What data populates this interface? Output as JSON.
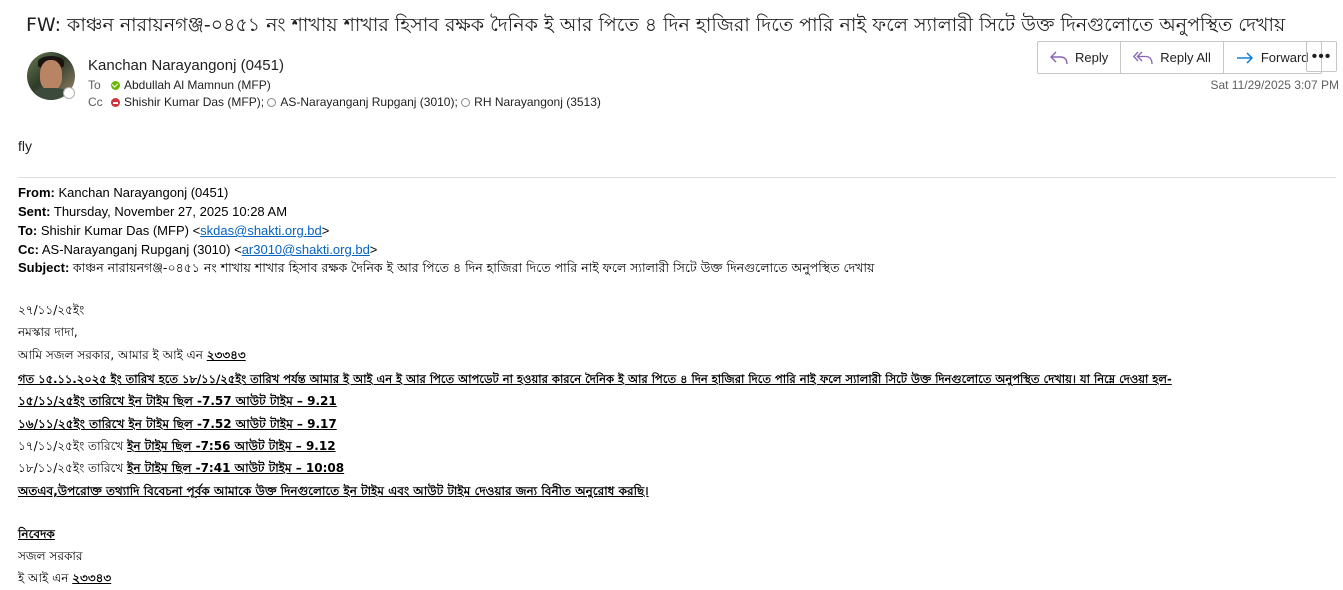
{
  "subject": "FW: কাঞ্চন নারায়নগঞ্জ-০৪৫১ নং শাখায়  শাখার হিসাব রক্ষক দৈনিক  ই আর পিতে ৪ দিন হাজিরা দিতে পারি নাই ফলে স্যালারী সিটে উক্ত দিনগুলোতে অনুপস্থিত দেখায়",
  "header": {
    "sender": "Kanchan  Narayangonj (0451)",
    "to_label": "To",
    "to": [
      {
        "name": "Abdullah Al Mamnun (MFP)",
        "status": "available"
      }
    ],
    "cc_label": "Cc",
    "cc": [
      {
        "name": "Shishir Kumar Das (MFP);",
        "status": "busy"
      },
      {
        "name": "AS-Narayanganj Rupganj (3010);",
        "status": "offline"
      },
      {
        "name": "RH Narayangonj (3513)",
        "status": "offline"
      }
    ],
    "date": "Sat 11/29/2025 3:07 PM"
  },
  "actions": {
    "reply": "Reply",
    "reply_all": "Reply All",
    "forward": "Forward",
    "more": "•••"
  },
  "colors": {
    "reply_icon": "#8764b8",
    "forward_icon": "#0078d4",
    "link": "#0563c1"
  },
  "body": {
    "intro": "fly",
    "forwarded": {
      "from_label": "From:",
      "from": "Kanchan Narayangonj (0451)",
      "sent_label": "Sent:",
      "sent": "Thursday, November 27, 2025 10:28 AM",
      "to_label": "To:",
      "to_name": "Shishir Kumar Das (MFP) <",
      "to_email": "skdas@shakti.org.bd",
      "to_close": ">",
      "cc_label": "Cc:",
      "cc_name": "AS-Narayanganj Rupganj (3010) <",
      "cc_email": "ar3010@shakti.org.bd",
      "cc_close": ">",
      "subject_label": "Subject:",
      "subject": "কাঞ্চন নারায়নগঞ্জ-০৪৫১ নং শাখায় শাখার হিসাব রক্ষক দৈনিক ই আর পিতে ৪ দিন হাজিরা দিতে পারি নাই ফলে স্যালারী সিটে উক্ত দিনগুলোতে অনুপস্থিত দেখায়"
    },
    "letter": {
      "date": "২৭/১১/২৫ইং",
      "greeting": "নমস্কার দাদা,",
      "intro_plain": "আমি সজল সরকার, আমার  ই আই এন ",
      "intro_id": "২৩৩৪৩",
      "paragraph": "গত ১৫.১১.২০২৫ ইং তারিখ হতে ১৮/১১/২৫ইং তারিখ পর্যন্ত  আমার ই আই এন  ই আর পিতে আপডেট না হওয়ার কারনে দৈনিক  ই আর পিতে ৪ দিন হাজিরা দিতে পারি নাই ফলে স্যালারী সিটে উক্ত দিনগুলোতে অনুপস্থিত দেখায়। যা নিম্নে দেওয়া হল-",
      "line1": "১৫/১১/২৫ইং তারিখে ইন টাইম ছিল -7.57 আউট টাইম – 9.21",
      "line2": "১৬/১১/২৫ইং তারিখে ইন টাইম ছিল -7.52 আউট টাইম – 9.17",
      "line3_plain": "১৭/১১/২৫ইং তারিখে ",
      "line3_u": "ইন টাইম ছিল -7:56 আউট টাইম – 9.12",
      "line4_plain": "১৮/১১/২৫ইং তারিখে ",
      "line4_u": "ইন টাইম ছিল -7:41 আউট টাইম – 10:08",
      "request": "অতএব,উপরোক্ত তথ্যাদি বিবেচনা পূর্বক আমাকে উক্ত দিনগুলোতে ইন টাইম এবং আউট টাইম দেওয়ার জন্য বিনীত অনুরোধ করছি।",
      "sign_label": "নিবেদক",
      "sign_name": "সজল সরকার",
      "sign_id_plain": "ই আই এন ",
      "sign_id": "২৩৩৪৩"
    }
  }
}
